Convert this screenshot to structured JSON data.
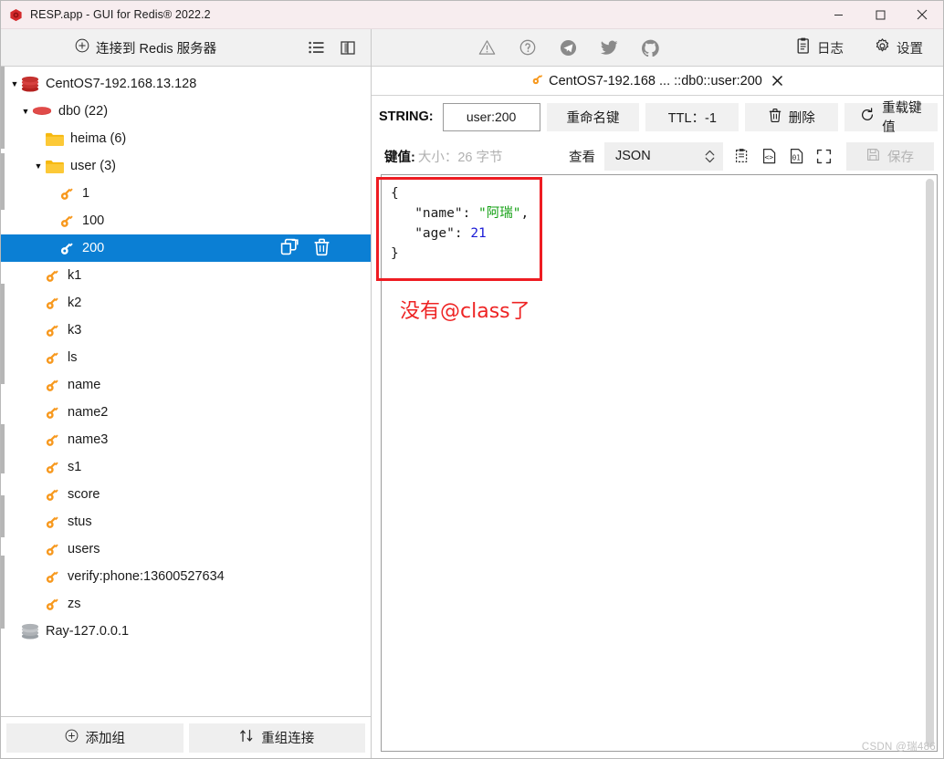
{
  "window": {
    "title": "RESP.app - GUI for Redis® 2022.2",
    "logo_icon": "redis-hexagon-logo",
    "minimize_icon": "minimize-icon",
    "maximize_icon": "maximize-icon",
    "close_icon": "close-icon"
  },
  "toolbar": {
    "connect_label": "连接到 Redis 服务器",
    "connect_icon": "plus-circle-icon",
    "list_icon": "list-view-icon",
    "split_icon": "split-pane-icon",
    "social": [
      {
        "icon": "warning-triangle-icon",
        "name": "warning"
      },
      {
        "icon": "question-circle-icon",
        "name": "help"
      },
      {
        "icon": "telegram-icon",
        "name": "telegram"
      },
      {
        "icon": "twitter-icon",
        "name": "twitter"
      },
      {
        "icon": "github-icon",
        "name": "github"
      }
    ],
    "log_label": "日志",
    "log_icon": "clipboard-icon",
    "settings_label": "设置",
    "settings_icon": "gear-icon"
  },
  "sidebar": {
    "tree": [
      {
        "label": "CentOS7-192.168.13.128",
        "icon": "redis-server-icon",
        "indent": 0,
        "arrow": "down",
        "count": "",
        "selected": false
      },
      {
        "label": "db0",
        "icon": "database-icon",
        "indent": 1,
        "arrow": "down",
        "count": "(22)",
        "selected": false
      },
      {
        "label": "heima",
        "icon": "folder-icon",
        "indent": 2,
        "arrow": "none",
        "count": "(6)",
        "selected": false
      },
      {
        "label": "user",
        "icon": "folder-icon",
        "indent": 2,
        "arrow": "down",
        "count": "(3)",
        "selected": false
      },
      {
        "label": "1",
        "icon": "key-icon",
        "indent": 3,
        "arrow": "none",
        "count": "",
        "selected": false
      },
      {
        "label": "100",
        "icon": "key-icon",
        "indent": 3,
        "arrow": "none",
        "count": "",
        "selected": false
      },
      {
        "label": "200",
        "icon": "key-icon",
        "indent": 3,
        "arrow": "none",
        "count": "",
        "selected": true
      },
      {
        "label": "k1",
        "icon": "key-icon",
        "indent": 2,
        "arrow": "none",
        "count": "",
        "selected": false
      },
      {
        "label": "k2",
        "icon": "key-icon",
        "indent": 2,
        "arrow": "none",
        "count": "",
        "selected": false
      },
      {
        "label": "k3",
        "icon": "key-icon",
        "indent": 2,
        "arrow": "none",
        "count": "",
        "selected": false
      },
      {
        "label": "ls",
        "icon": "key-icon",
        "indent": 2,
        "arrow": "none",
        "count": "",
        "selected": false
      },
      {
        "label": "name",
        "icon": "key-icon",
        "indent": 2,
        "arrow": "none",
        "count": "",
        "selected": false
      },
      {
        "label": "name2",
        "icon": "key-icon",
        "indent": 2,
        "arrow": "none",
        "count": "",
        "selected": false
      },
      {
        "label": "name3",
        "icon": "key-icon",
        "indent": 2,
        "arrow": "none",
        "count": "",
        "selected": false
      },
      {
        "label": "s1",
        "icon": "key-icon",
        "indent": 2,
        "arrow": "none",
        "count": "",
        "selected": false
      },
      {
        "label": "score",
        "icon": "key-icon",
        "indent": 2,
        "arrow": "none",
        "count": "",
        "selected": false
      },
      {
        "label": "stus",
        "icon": "key-icon",
        "indent": 2,
        "arrow": "none",
        "count": "",
        "selected": false
      },
      {
        "label": "users",
        "icon": "key-icon",
        "indent": 2,
        "arrow": "none",
        "count": "",
        "selected": false
      },
      {
        "label": "verify:phone:13600527634",
        "icon": "key-icon",
        "indent": 2,
        "arrow": "none",
        "count": "",
        "selected": false
      },
      {
        "label": "zs",
        "icon": "key-icon",
        "indent": 2,
        "arrow": "none",
        "count": "",
        "selected": false
      },
      {
        "label": "Ray-127.0.0.1",
        "icon": "redis-server-icon-grey",
        "indent": 0,
        "arrow": "none",
        "count": "",
        "selected": false
      }
    ],
    "row_actions": {
      "copy_icon": "copy-link-icon",
      "delete_icon": "trash-icon"
    },
    "footer": {
      "add_group_label": "添加组",
      "add_group_icon": "plus-circle-icon",
      "regroup_label": "重组连接",
      "regroup_icon": "sort-arrows-icon"
    }
  },
  "main": {
    "tab": {
      "icon": "key-icon",
      "label": "CentOS7-192.168 ... ::db0::user:200",
      "close_icon": "close-icon"
    },
    "key_row": {
      "type_label": "STRING:",
      "key_name_value": "user:200",
      "rename_label": "重命名键",
      "ttl_label": "TTL：-1",
      "delete_label": "删除",
      "delete_icon": "trash-icon",
      "reload_label": "重载键值",
      "reload_icon": "refresh-icon"
    },
    "value_row": {
      "value_label": "键值:",
      "size_label": "大小：26 字节",
      "view_label": "查看",
      "view_value": "JSON",
      "spinner_icon": "updown-chevron-icon",
      "icons": [
        {
          "icon": "clipboard-paste-icon",
          "name": "paste"
        },
        {
          "icon": "code-file-icon",
          "name": "format-code"
        },
        {
          "icon": "binary-file-icon",
          "name": "binary"
        },
        {
          "icon": "fullscreen-icon",
          "name": "fullscreen"
        }
      ],
      "save_label": "保存",
      "save_icon": "floppy-disk-icon"
    },
    "editor": {
      "lines": [
        {
          "segments": [
            {
              "text": "{",
              "cls": "j-key"
            }
          ]
        },
        {
          "segments": [
            {
              "text": "   \"name\": ",
              "cls": "j-key"
            },
            {
              "text": "\"阿瑞\"",
              "cls": "j-str"
            },
            {
              "text": ",",
              "cls": "j-key"
            }
          ]
        },
        {
          "segments": [
            {
              "text": "   \"age\": ",
              "cls": "j-key"
            },
            {
              "text": "21",
              "cls": "j-num"
            }
          ]
        },
        {
          "segments": [
            {
              "text": "}",
              "cls": "j-key"
            }
          ]
        }
      ]
    },
    "annotation_text": "没有@class了"
  },
  "watermark": "CSDN @瑞486",
  "colors": {
    "accent_selection": "#0b7fd4",
    "key_icon": "#f7981d",
    "folder_icon": "#fcb813",
    "annotation_red": "#ee1c22",
    "string_green": "#14a014",
    "number_blue": "#1a1ad6"
  }
}
